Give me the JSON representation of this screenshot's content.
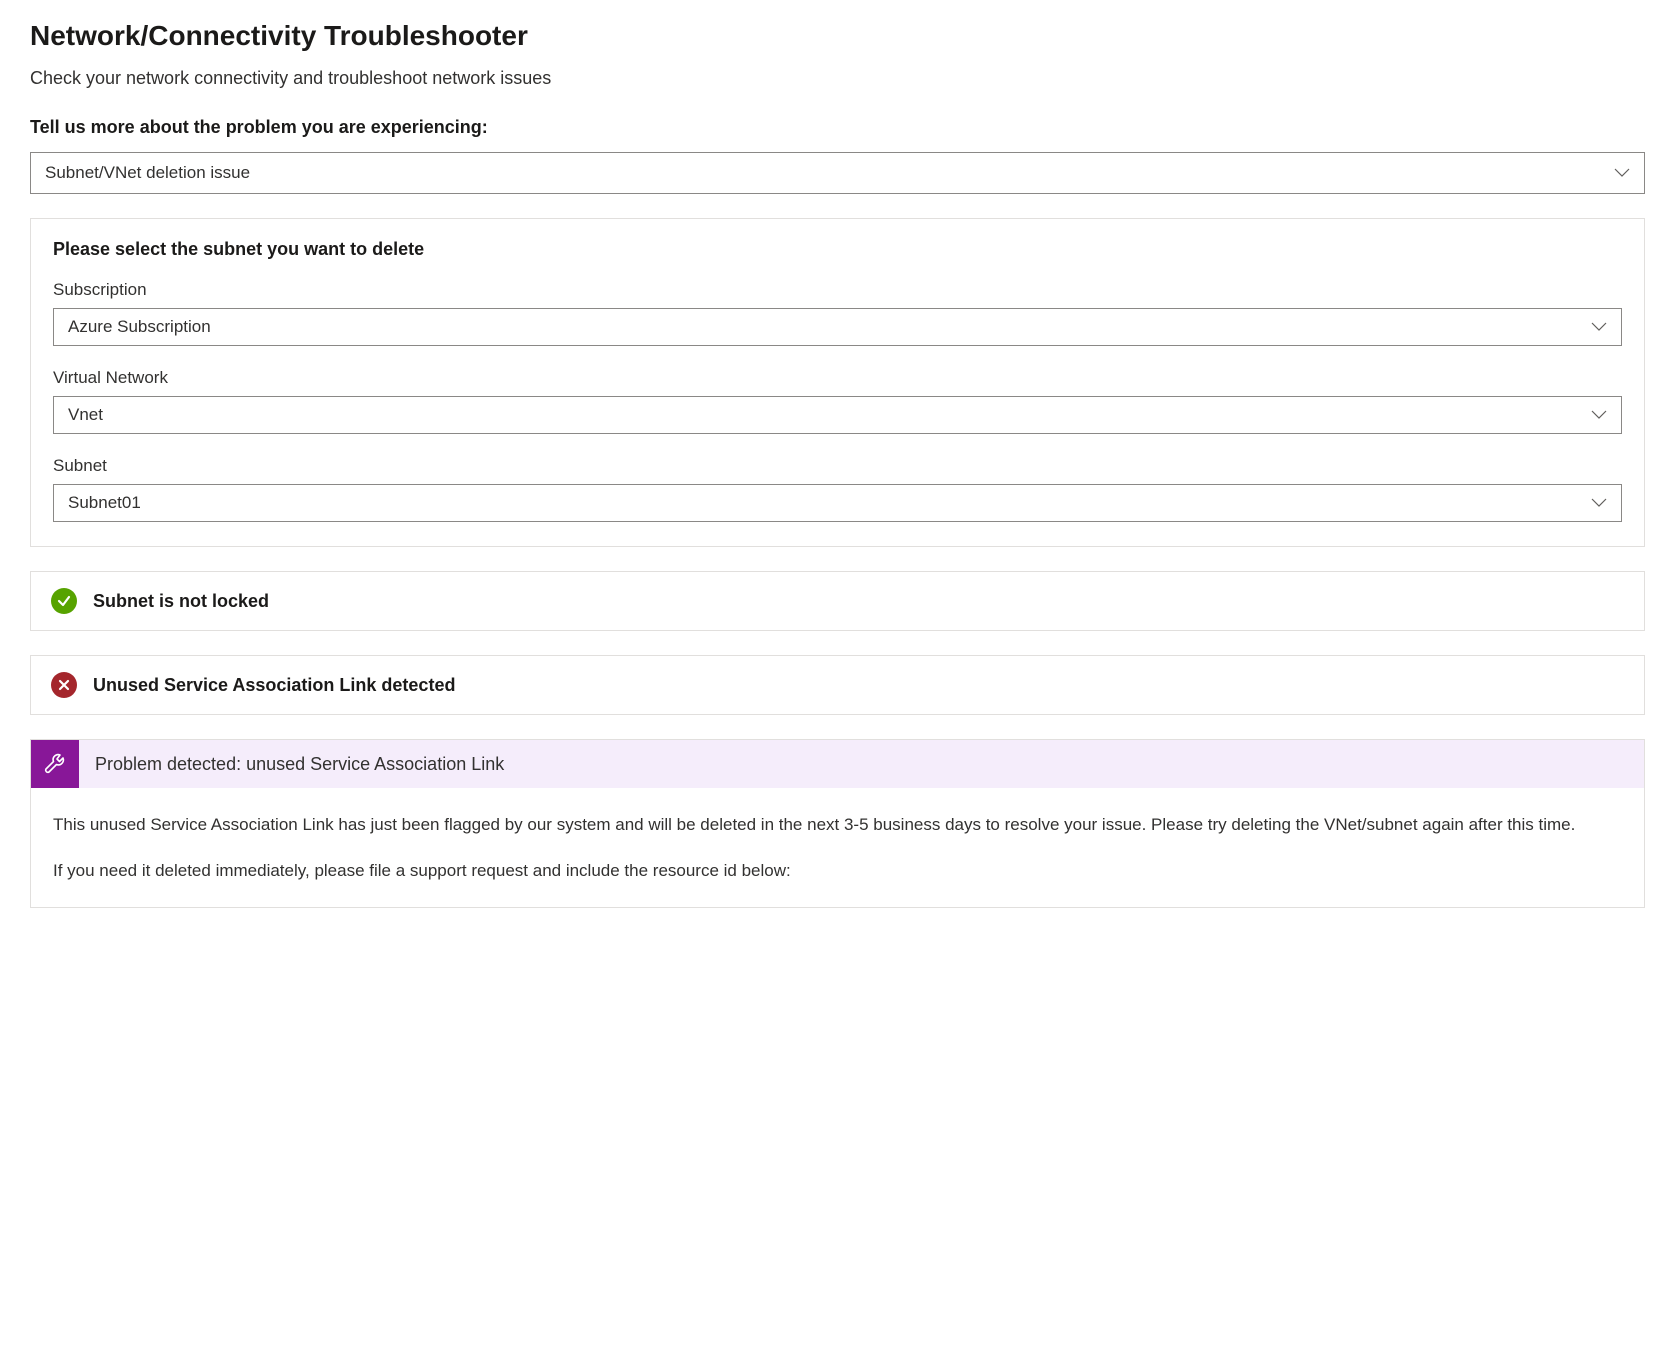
{
  "header": {
    "title": "Network/Connectivity Troubleshooter",
    "subtitle": "Check your network connectivity and troubleshoot network issues"
  },
  "problemSelector": {
    "label": "Tell us more about the problem you are experiencing:",
    "value": "Subnet/VNet deletion issue"
  },
  "subnetForm": {
    "heading": "Please select the subnet you want to delete",
    "fields": {
      "subscription": {
        "label": "Subscription",
        "value": "Azure Subscription"
      },
      "virtualNetwork": {
        "label": "Virtual Network",
        "value": "Vnet"
      },
      "subnet": {
        "label": "Subnet",
        "value": "Subnet01"
      }
    }
  },
  "statusChecks": {
    "lockStatus": "Subnet is not locked",
    "salStatus": "Unused Service Association Link detected"
  },
  "problemDetail": {
    "title": "Problem detected: unused Service Association Link",
    "paragraph1": "This unused Service Association Link has just been flagged by our system and will be deleted in the next 3-5 business days to resolve your issue. Please try deleting the VNet/subnet again after this time.",
    "paragraph2": "If you need it deleted immediately, please file a support request and include the resource id below:"
  }
}
